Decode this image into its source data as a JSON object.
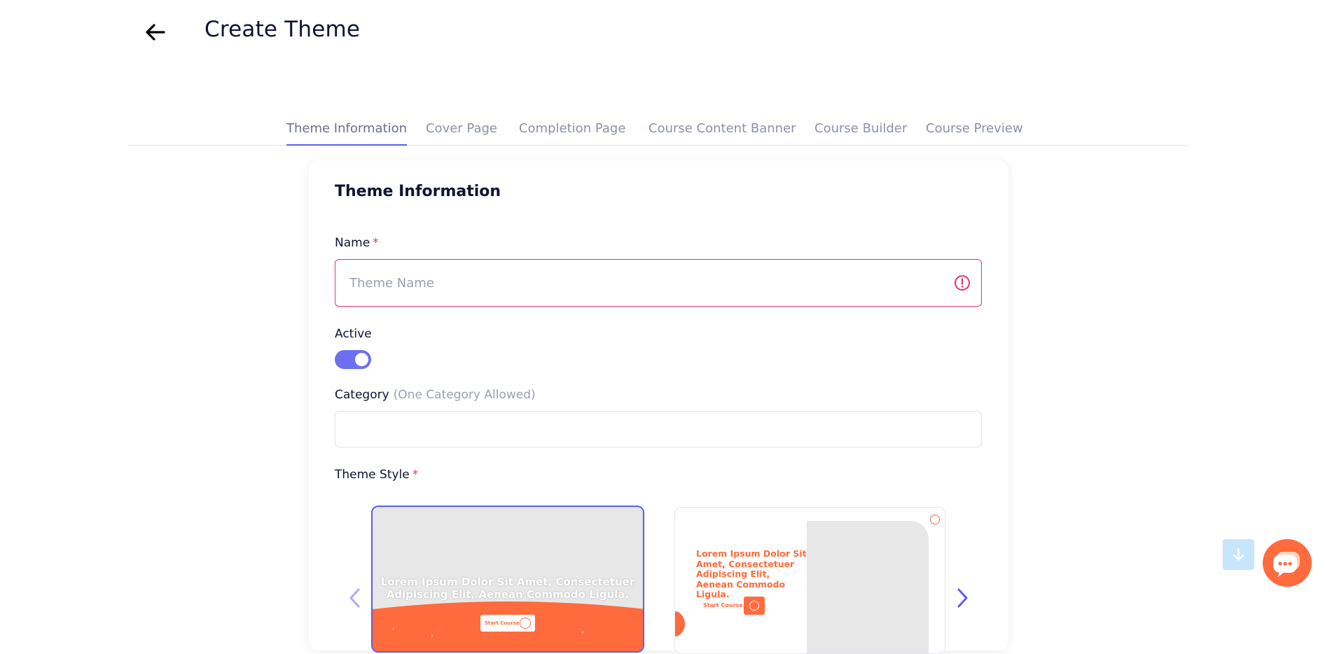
{
  "header": {
    "title": "Create Theme"
  },
  "tabs": [
    {
      "label": "Theme Information",
      "active": true
    },
    {
      "label": "Cover Page",
      "active": false
    },
    {
      "label": "Completion Page",
      "active": false
    },
    {
      "label": "Course Content Banner",
      "active": false
    },
    {
      "label": "Course Builder",
      "active": false
    },
    {
      "label": "Course Preview",
      "active": false
    }
  ],
  "form": {
    "section_title": "Theme Information",
    "name": {
      "label": "Name",
      "required_mark": "*",
      "placeholder": "Theme Name",
      "value": ""
    },
    "active": {
      "label": "Active",
      "on": true
    },
    "category": {
      "label": "Category",
      "hint": "(One Category Allowed)",
      "value": ""
    },
    "theme_style": {
      "label": "Theme Style",
      "required_mark": "*"
    }
  },
  "theme_styles": [
    {
      "selected": true,
      "text": "Lorem Ipsum Dolor Sit Amet, Consectetuer Adipiscing Elit, Aenean Commodo Ligula.",
      "button": "Start Course"
    },
    {
      "selected": false,
      "text": "Lorem Ipsum Dolor Sit Amet, Consectetuer Adipiscing Elit, Aenean Commodo Ligula.",
      "button": "Start Course"
    }
  ],
  "colors": {
    "accent": "#5b5ff0",
    "error": "#e8336b",
    "brand_orange": "#ff6b3d",
    "scroll_button": "#c8e6fb"
  },
  "icons": [
    "arrow-left-icon",
    "alert-circle-icon",
    "chevron-left-icon",
    "chevron-right-icon",
    "arrow-down-icon",
    "chat-icon",
    "play-icon"
  ]
}
